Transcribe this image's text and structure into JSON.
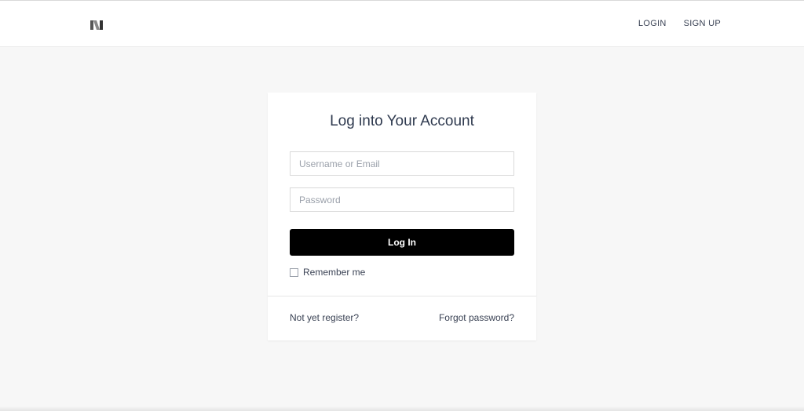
{
  "header": {
    "logo_icon": "brand-logo-icon",
    "nav": {
      "login_label": "LOGIN",
      "signup_label": "SIGN UP"
    }
  },
  "login_card": {
    "title": "Log into Your Account",
    "username_field": {
      "placeholder": "Username or Email",
      "value": ""
    },
    "password_field": {
      "placeholder": "Password",
      "value": ""
    },
    "submit_label": "Log In",
    "remember_label": "Remember me",
    "remember_checked": false,
    "register_link": "Not yet register?",
    "forgot_link": "Forgot password?"
  },
  "colors": {
    "background": "#f7f7f7",
    "card": "#ffffff",
    "button": "#000000",
    "text": "#3a4254"
  }
}
